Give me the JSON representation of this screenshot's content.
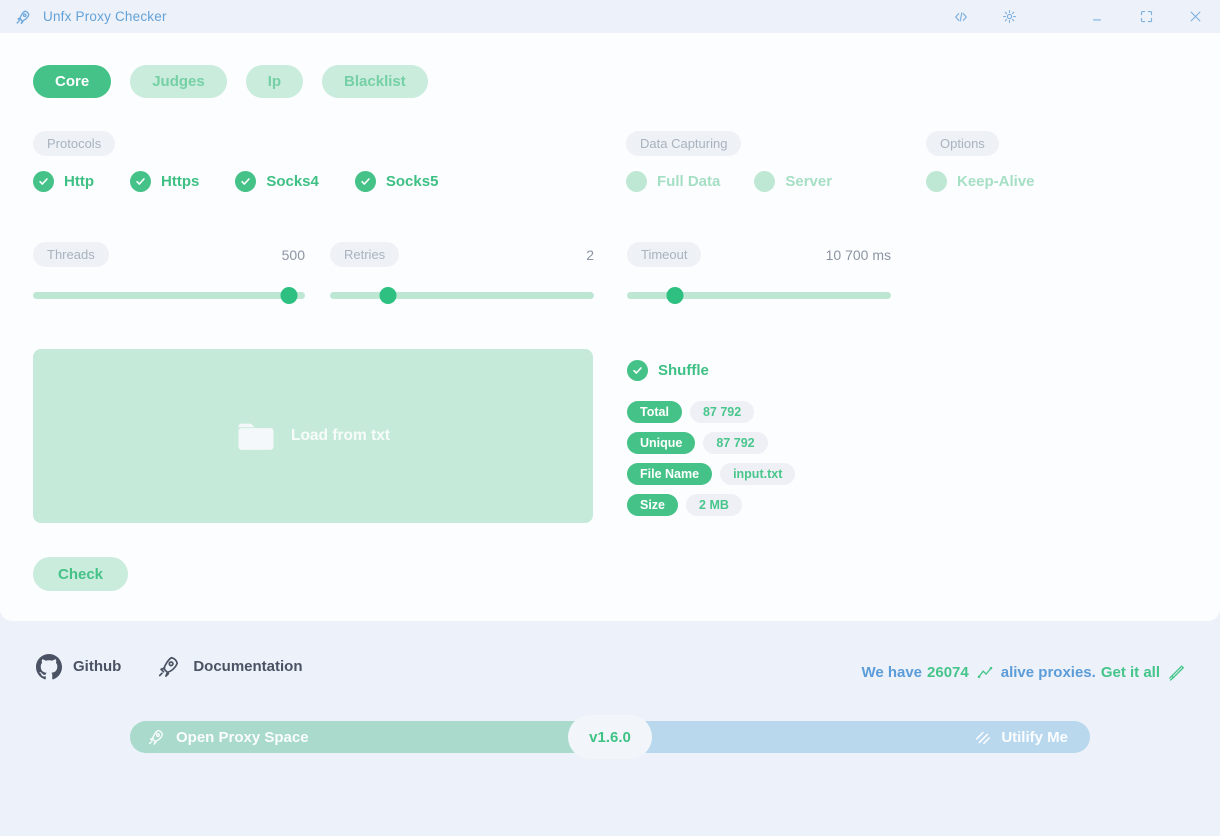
{
  "window": {
    "title": "Unfx Proxy Checker"
  },
  "colors": {
    "accent_green": "#44c287",
    "knob_green": "#2dc081",
    "light_green": "#c9ecdc",
    "track_green": "#bde7d3",
    "badge_gray": "#eef0f5",
    "title_blue": "#63a2d8",
    "footer_dark": "#4a5263",
    "promo_blue": "#5b9cd9",
    "bar_teal": "#a9dacc",
    "bar_blue": "#b9d8ee"
  },
  "icons": {
    "titlebar": [
      "rocket-icon",
      "code-icon",
      "sun-icon",
      "minimize-icon",
      "maximize-icon",
      "close-icon"
    ],
    "content": [
      "check-icon",
      "folder-icon"
    ],
    "footer": [
      "github-icon",
      "rocket-icon",
      "pulse-icon",
      "pencil-icon",
      "stripes-icon"
    ]
  },
  "tabs": {
    "items": [
      {
        "label": "Core",
        "active": true
      },
      {
        "label": "Judges",
        "active": false
      },
      {
        "label": "Ip",
        "active": false
      },
      {
        "label": "Blacklist",
        "active": false
      }
    ]
  },
  "sections": {
    "protocols": {
      "label": "Protocols",
      "items": [
        {
          "label": "Http",
          "checked": true
        },
        {
          "label": "Https",
          "checked": true
        },
        {
          "label": "Socks4",
          "checked": true
        },
        {
          "label": "Socks5",
          "checked": true
        }
      ]
    },
    "data_capturing": {
      "label": "Data Capturing",
      "items": [
        {
          "label": "Full Data",
          "checked": false
        },
        {
          "label": "Server",
          "checked": false
        }
      ]
    },
    "options": {
      "label": "Options",
      "items": [
        {
          "label": "Keep-Alive",
          "checked": false
        }
      ]
    }
  },
  "sliders": [
    {
      "label": "Threads",
      "value": "500",
      "percent": "94%"
    },
    {
      "label": "Retries",
      "value": "2",
      "percent": "22%"
    },
    {
      "label": "Timeout",
      "value": "10 700 ms",
      "percent": "18%"
    }
  ],
  "file_loader": {
    "label": "Load from txt"
  },
  "shuffle": {
    "label": "Shuffle",
    "checked": true
  },
  "file_stats": [
    {
      "key": "Total",
      "value": "87 792"
    },
    {
      "key": "Unique",
      "value": "87 792"
    },
    {
      "key": "File Name",
      "value": "input.txt"
    },
    {
      "key": "Size",
      "value": "2 MB"
    }
  ],
  "check_button": {
    "label": "Check"
  },
  "footer": {
    "github_label": "Github",
    "docs_label": "Documentation",
    "promo": {
      "we_have": "We have",
      "count": "26074",
      "alive": "alive proxies.",
      "get_it_all": "Get it all"
    }
  },
  "bottom_bar": {
    "left_label": "Open Proxy Space",
    "version": "v1.6.0",
    "right_label": "Utilify Me"
  }
}
